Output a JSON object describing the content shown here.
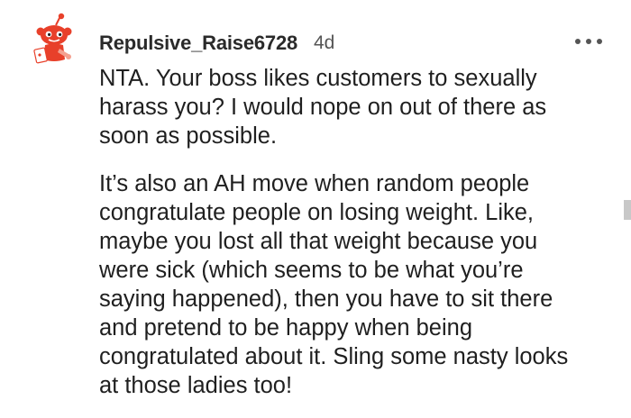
{
  "comment": {
    "username": "Repulsive_Raise6728",
    "age": "4d",
    "more_icon": "more-horizontal-icon",
    "avatar_icon": "snoo-avatar-icon",
    "paragraphs": [
      {
        "lines": [
          "NTA. Your boss likes customers to sexually",
          "harass you? I would nope on out of there as",
          "soon as possible."
        ]
      },
      {
        "lines": [
          "It’s also an AH move when random people",
          "congratulate people on losing weight. Like,",
          "maybe you lost all that weight because you",
          "were sick (which seems to be what you’re",
          "saying happened), then you have to sit there",
          "and pretend to be happy when being",
          "congratulated about it. Sling some nasty looks",
          "at those ladies too!"
        ]
      }
    ]
  },
  "colors": {
    "avatar_red": "#e8402a",
    "text": "#1f1f1f",
    "meta": "#555555"
  }
}
